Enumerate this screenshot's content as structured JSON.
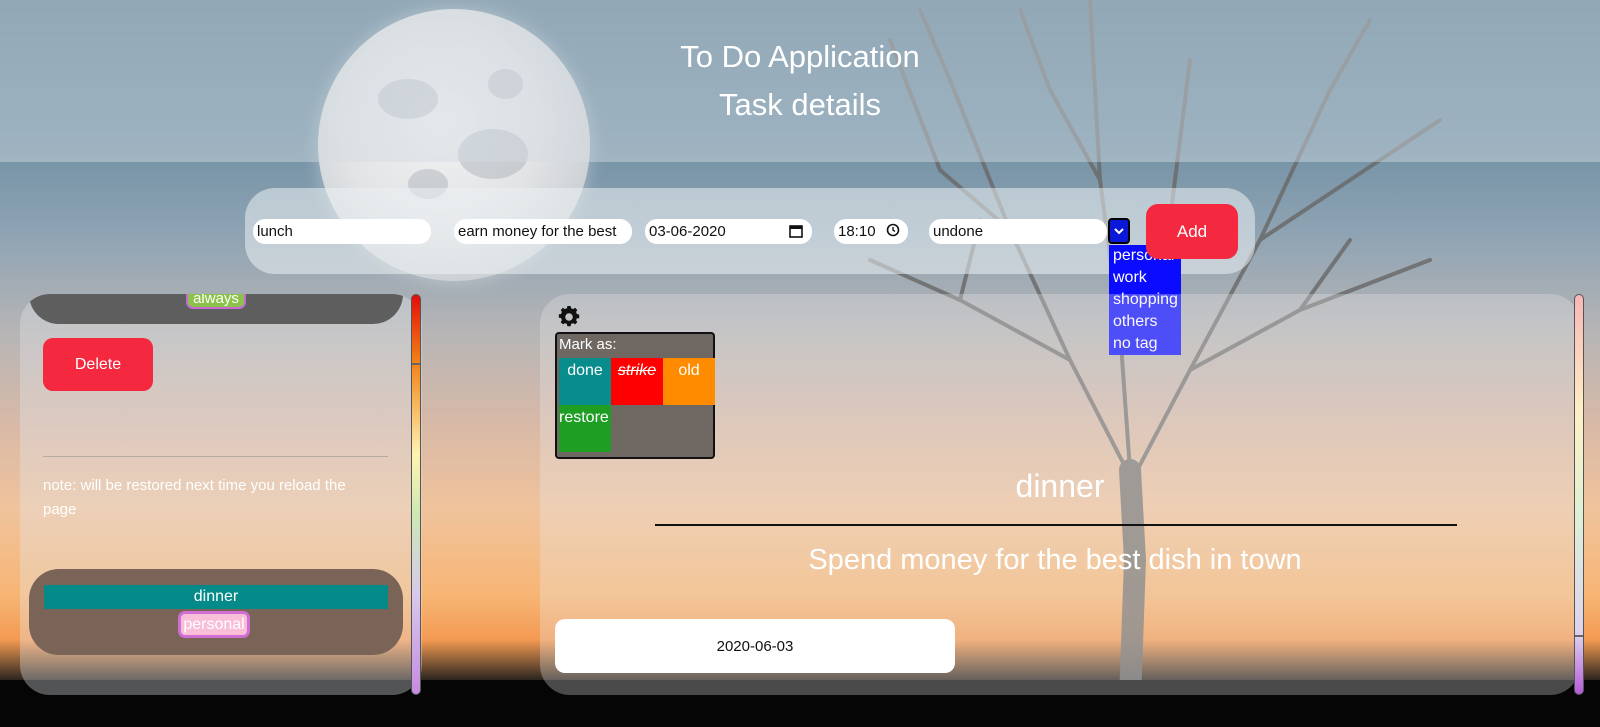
{
  "header": {
    "app_title": "To Do Application",
    "page_title": "Task details"
  },
  "form": {
    "title_value": "lunch",
    "description_value": "earn money for the best",
    "date_value": "03-06-2020",
    "time_value": "18:10",
    "status_value": "undone",
    "tag_options": [
      "personal",
      "work",
      "shopping",
      "others",
      "no tag"
    ],
    "add_label": "Add"
  },
  "left_panel": {
    "top_card_tag": "always",
    "delete_label": "Delete",
    "note": "note: will be restored next time you reload the page",
    "bottom_card": {
      "title": "dinner",
      "tag": "personal"
    }
  },
  "details": {
    "mark_as_label": "Mark as:",
    "mark_buttons": {
      "done": "done",
      "strike": "strike",
      "old": "old",
      "restore": "restore"
    },
    "task_title": "dinner",
    "task_description": "Spend money for the best dish in town",
    "task_date": "2020-06-03"
  },
  "icons": {
    "settings": "gear-icon",
    "calendar": "calendar-icon",
    "clock": "clock-icon",
    "dropdown": "chevron-down-icon"
  },
  "colors": {
    "accent_red": "#f4293f",
    "teal": "#088c8c",
    "dropdown_blue": "#0b0bff",
    "tag_green": "#8bc34a",
    "tag_pink": "#f9bed8"
  }
}
